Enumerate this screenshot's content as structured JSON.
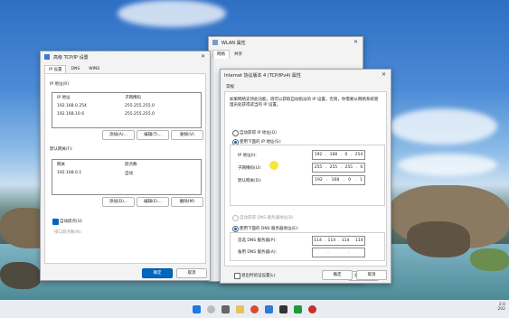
{
  "tcpip_advanced": {
    "title": "高级 TCP/IP 设置",
    "close": "✕",
    "tabs": [
      "IP 设置",
      "DNS",
      "WINS"
    ],
    "ip_group_label": "IP 地址(R)",
    "ip_columns": [
      "IP 地址",
      "子网掩码"
    ],
    "ip_rows": [
      {
        "ip": "192.168.0.254",
        "mask": "255.255.255.0"
      },
      {
        "ip": "192.168.10.6",
        "mask": "255.255.255.0"
      }
    ],
    "ip_buttons": [
      "添加(A)...",
      "编辑(T)...",
      "删除(V)"
    ],
    "gw_group_label": "默认网关(F):",
    "gw_columns": [
      "网关",
      "跃点数"
    ],
    "gw_rows": [
      {
        "gateway": "192.168.0.1",
        "metric": "自动"
      }
    ],
    "gw_buttons": [
      "添加(D)...",
      "编辑(E)...",
      "删除(M)"
    ],
    "auto_metric_label": "自动跃点(U)",
    "interface_metric_label": "接口跃点数(N):",
    "ok": "确定",
    "cancel": "取消"
  },
  "wlan_props": {
    "title": "WLAN 属性",
    "tabs": [
      "网络",
      "共享"
    ],
    "close": "✕"
  },
  "ipv4_props": {
    "title": "Internet 协议版本 4 (TCP/IPv4) 属性",
    "close": "✕",
    "tab": "常规",
    "description": "如果网络支持此功能，则可以获取自动指派的 IP 设置。否则，你需要从网络系统管理员处获得适当的 IP 设置。",
    "auto_ip_label": "自动获得 IP 地址(O)",
    "manual_ip_label": "使用下面的 IP 地址(S):",
    "ip_label": "IP 地址(I):",
    "ip_value": [
      "192",
      "168",
      "0",
      "254"
    ],
    "mask_label": "子网掩码(U):",
    "mask_value": [
      "255",
      "255",
      "255",
      "0"
    ],
    "gw_label": "默认网关(D):",
    "gw_value": [
      "192",
      "168",
      "0",
      "1"
    ],
    "auto_dns_label": "自动获得 DNS 服务器地址(B)",
    "manual_dns_label": "使用下面的 DNS 服务器地址(E):",
    "pref_dns_label": "首选 DNS 服务器(P):",
    "pref_dns_value": [
      "114",
      "114",
      "114",
      "114"
    ],
    "alt_dns_label": "备用 DNS 服务器(A):",
    "alt_dns_value": [
      "",
      "",
      "",
      ""
    ],
    "validate_label": "退出时验证设置(L)",
    "advanced": "高级(V)...",
    "ok": "确定",
    "cancel": "取消"
  },
  "tray": {
    "time": "2:0",
    "date": "202"
  },
  "colors": {
    "accent": "#0067c0",
    "cursor_highlight": "#f5e83a"
  }
}
